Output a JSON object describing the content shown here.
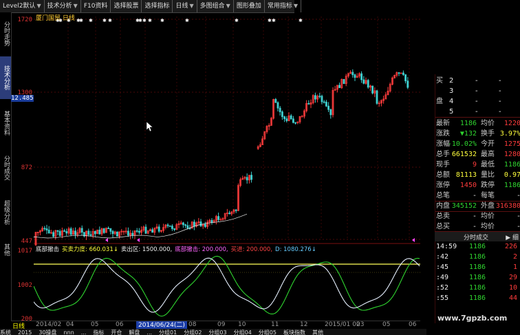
{
  "toolbar": [
    {
      "label": "Level2默认",
      "arrow": "▼"
    },
    {
      "label": "技术分析",
      "arrow": "▼"
    },
    {
      "label": "F10资料",
      "arrow": ""
    },
    {
      "label": "选择股票",
      "arrow": ""
    },
    {
      "label": "选择指标",
      "arrow": ""
    },
    {
      "label": "日线",
      "arrow": "▼"
    },
    {
      "label": "多图组合",
      "arrow": "▼"
    },
    {
      "label": "图形叠加",
      "arrow": ""
    },
    {
      "label": "常用指标",
      "arrow": "▼"
    }
  ],
  "left_tabs": [
    "分时走势",
    "技术分析",
    "基本资料",
    "分时成交",
    "超级分析",
    "其他"
  ],
  "left_active": 1,
  "price_axis": {
    "top": "1720",
    "mid": "1300",
    "current": "12.485",
    "lower": "872",
    "bottom": "447"
  },
  "chart_title": "厦门国贸 日线",
  "indicator_axis": {
    "top": "1017",
    "mid": "1002",
    "bottom": "200"
  },
  "indicator_legend": [
    {
      "text": "底部撤击",
      "color": "#eeeeee"
    },
    {
      "text": "买卖力度: 660.031↓",
      "color": "#ffff3c"
    },
    {
      "text": "卖出区: 1500.000,",
      "color": "#eeeeee"
    },
    {
      "text": "底部撤击: 200.000,",
      "color": "#ff66ff"
    },
    {
      "text": "买进: 200.000,",
      "color": "#ff4444"
    },
    {
      "text": "D: 1080.276↓",
      "color": "#66ccff"
    }
  ],
  "date_axis": {
    "period": "日线",
    "labels": [
      "2014/02",
      "04",
      "05",
      "06",
      "",
      "08",
      "09",
      "10",
      "11",
      "12",
      "2015/01 02",
      "03",
      "05",
      "06"
    ],
    "highlight": "2014/06/24(二)"
  },
  "bottom_tabs": [
    "系统",
    "2015",
    "30操盘",
    "nnn",
    "...",
    "指标",
    "开仓",
    "解盘",
    "...",
    "分组01",
    "分组02",
    "分组03",
    "分组04",
    "分组05",
    "板块指数",
    "其他"
  ],
  "quote_panel": {
    "order_rows": [
      {
        "label": "买",
        "num": "2",
        "v1": "-",
        "v2": "-"
      },
      {
        "label": "",
        "num": "3",
        "v1": "-",
        "v2": "-"
      },
      {
        "label": "盘",
        "num": "4",
        "v1": "-",
        "v2": "-"
      },
      {
        "label": "",
        "num": "5",
        "v1": "-",
        "v2": "-"
      }
    ],
    "stats": [
      {
        "l1": "最新",
        "v1": "1186",
        "c1": "green",
        "l2": "均价",
        "v2": "1220",
        "c2": "red"
      },
      {
        "l1": "涨跌",
        "v1": "▼132",
        "c1": "green",
        "l2": "换手",
        "v2": "3.97%",
        "c2": "yellow"
      },
      {
        "l1": "涨幅",
        "v1": "-10.02%",
        "c1": "green",
        "l2": "今开",
        "v2": "1275",
        "c2": "red"
      },
      {
        "l1": "总手",
        "v1": "661532",
        "c1": "yellow",
        "l2": "最高",
        "v2": "1280",
        "c2": "red"
      },
      {
        "l1": "现手",
        "v1": "9",
        "c1": "red",
        "l2": "最低",
        "v2": "1186",
        "c2": "green"
      },
      {
        "l1": "总额",
        "v1": "81113",
        "c1": "yellow",
        "l2": "量比",
        "v2": "0.97",
        "c2": "yellow"
      },
      {
        "l1": "涨停",
        "v1": "1450",
        "c1": "red",
        "l2": "跌停",
        "v2": "1186",
        "c2": "green"
      },
      {
        "l1": "总笔",
        "v1": "-",
        "c1": "white",
        "l2": "每笔",
        "v2": "-",
        "c2": "white"
      },
      {
        "l1": "内盘",
        "v1": "345152",
        "c1": "green",
        "l2": "外盘",
        "v2": "316380",
        "c2": "red"
      },
      {
        "l1": "总卖",
        "v1": "-",
        "c1": "white",
        "l2": "均价",
        "v2": "-",
        "c2": "white"
      },
      {
        "l1": "总买",
        "v1": "-",
        "c1": "white",
        "l2": "均价",
        "v2": "-",
        "c2": "white"
      }
    ],
    "ts_title": "分时成交",
    "ts_side": "▶ 细",
    "ticks": [
      {
        "time": "14:59",
        "price": "1186",
        "vol": "226"
      },
      {
        "time": ":42",
        "price": "1186",
        "vol": "2"
      },
      {
        "time": ":45",
        "price": "1186",
        "vol": "1"
      },
      {
        "time": ":49",
        "price": "1186",
        "vol": "29"
      },
      {
        "time": ":52",
        "price": "1186",
        "vol": "10"
      },
      {
        "time": ":55",
        "price": "1186",
        "vol": "44"
      }
    ]
  },
  "watermark": "www.7gpzb.com",
  "colors": {
    "up": "#ff3c3c",
    "down": "#2fd52f",
    "price_axis": "#dd3333",
    "line_white": "#e6f0ff",
    "line_green": "#2fd52f",
    "threshold": "#d8d84a"
  }
}
